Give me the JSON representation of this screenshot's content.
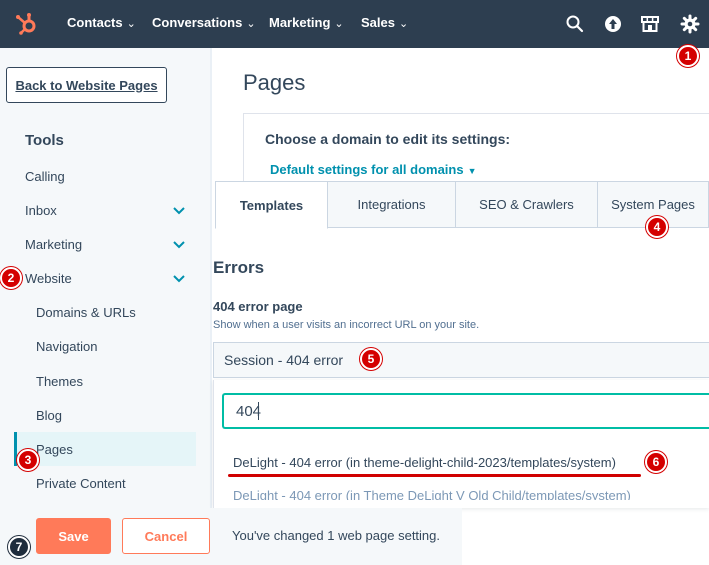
{
  "nav": {
    "items": [
      {
        "label": "Contacts",
        "chevron": "⌄"
      },
      {
        "label": "Conversations",
        "chevron": "⌄"
      },
      {
        "label": "Marketing",
        "chevron": "⌄"
      },
      {
        "label": "Sales",
        "chevron": "⌄"
      }
    ],
    "icons": [
      "hubspot-logo-icon",
      "search-icon",
      "upgrade-icon",
      "marketplace-icon",
      "settings-gear-icon"
    ],
    "bg_color": "#2d3e50"
  },
  "sidebar": {
    "back_label": "Back to Website Pages",
    "heading": "Tools",
    "items": [
      "Calling",
      "Inbox",
      "Marketing",
      "Website"
    ],
    "subitems": [
      "Domains & URLs",
      "Navigation",
      "Themes",
      "Blog",
      "Pages",
      "Private Content"
    ],
    "active": "Pages",
    "accent_color": "#0091ae"
  },
  "main": {
    "title": "Pages",
    "domain_prompt": "Choose a domain to edit its settings:",
    "domain_selected": "Default settings for all domains",
    "tabs": [
      "Templates",
      "Integrations",
      "SEO & Crawlers",
      "System Pages"
    ],
    "active_tab": "Templates",
    "section_title": "Errors",
    "field_label": "404 error page",
    "field_help": "Show when a user visits an incorrect URL on your site.",
    "dropdown_value": "Session - 404 error",
    "search_value": "404",
    "options": [
      "DeLight - 404 error (in theme-delight-child-2023/templates/system)",
      "DeLight - 404 error (in Theme DeLight V Old Child/templates/system)"
    ]
  },
  "footer": {
    "save_label": "Save",
    "cancel_label": "Cancel",
    "status": "You've changed 1 web page setting.",
    "save_color": "#ff7a59"
  },
  "markers": [
    "1",
    "2",
    "3",
    "4",
    "5",
    "6",
    "7"
  ],
  "colors": {
    "marker_red": "#d40000",
    "highlight_underline": "#d00000",
    "focus_border": "#00bda5"
  }
}
